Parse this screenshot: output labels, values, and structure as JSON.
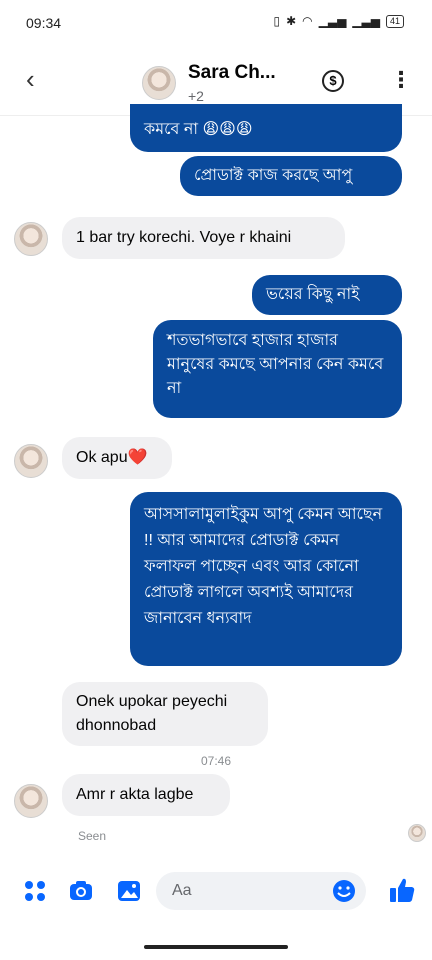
{
  "status_bar": {
    "time": "09:34",
    "battery": "41"
  },
  "header": {
    "name": "Sara Ch...",
    "subtitle": "+2"
  },
  "messages": {
    "m0": "কমবে না 😩😩😩",
    "m1": "প্রোডাক্ট কাজ করছে আপু",
    "m2": "1 bar try korechi. Voye r khaini",
    "m3": "ভয়ের কিছু নাই",
    "m4": "শতভাগভাবে  হাজার হাজার মানুষের কমছে আপনার কেন কমবে না",
    "m5": "Ok apu❤️",
    "m6": "আসসালামুলাইকুম আপু কেমন আছেন !!    আর আমাদের প্রোডাক্ট কেমন ফলাফল পাচ্ছেন এবং আর কোনো প্রোডাক্ট লাগলে অবশ্যই আমাদের জানাবেন ধন্যবাদ",
    "m7": "Onek upokar peyechi dhonnobad",
    "m8": "Amr r akta lagbe"
  },
  "timestamp": "07:46",
  "seen_label": "Seen",
  "composer": {
    "placeholder": "Aa"
  },
  "colors": {
    "outgoing": "#0a4a9c",
    "incoming": "#f0f0f2",
    "accent": "#0866ff"
  },
  "icons": [
    "back-icon",
    "dollar-icon",
    "more-icon",
    "apps-icon",
    "camera-icon",
    "gallery-icon",
    "emoji-icon",
    "like-icon"
  ]
}
